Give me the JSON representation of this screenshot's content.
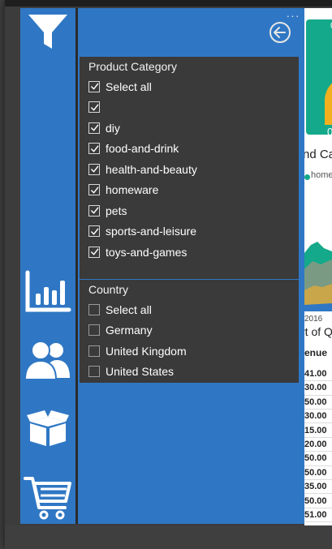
{
  "panel": {
    "back_icon": "back-arrow-icon",
    "more_icon": "ellipsis-icon",
    "more_label": "···"
  },
  "rail": {
    "items": [
      {
        "icon": "filter-icon"
      },
      {
        "icon": "bar-chart-icon"
      },
      {
        "icon": "users-icon"
      },
      {
        "icon": "box-icon"
      },
      {
        "icon": "shopping-cart-icon"
      }
    ]
  },
  "category_slicer": {
    "title": "Product Category",
    "items": [
      {
        "label": "Select all",
        "checked": true
      },
      {
        "label": "",
        "checked": true
      },
      {
        "label": "diy",
        "checked": true
      },
      {
        "label": "food-and-drink",
        "checked": true
      },
      {
        "label": "health-and-beauty",
        "checked": true
      },
      {
        "label": "homeware",
        "checked": true
      },
      {
        "label": "pets",
        "checked": true
      },
      {
        "label": "sports-and-leisure",
        "checked": true
      },
      {
        "label": "toys-and-games",
        "checked": true
      }
    ]
  },
  "country_slicer": {
    "title": "Country",
    "items": [
      {
        "label": "Select all",
        "checked": false
      },
      {
        "label": "Germany",
        "checked": false
      },
      {
        "label": "United Kingdom",
        "checked": false
      },
      {
        "label": "United States",
        "checked": false
      }
    ]
  },
  "report_peek": {
    "card_top": "0",
    "card_bottom": "0",
    "heading": "nd Ca",
    "legend": "homew",
    "axis_year": "2016",
    "table_title": "rt of Q",
    "column_header": "enue",
    "revenue_values": [
      "41.00",
      "30.00",
      "50.00",
      "30.00",
      "15.00",
      "20.00",
      "50.00",
      "50.00",
      "35.00",
      "50.00",
      "51.00"
    ]
  },
  "colors": {
    "accent": "#2f77c4",
    "slicer_bg": "#3a3a3a",
    "card": "#14a98a",
    "gauge": "#f2b01e"
  }
}
